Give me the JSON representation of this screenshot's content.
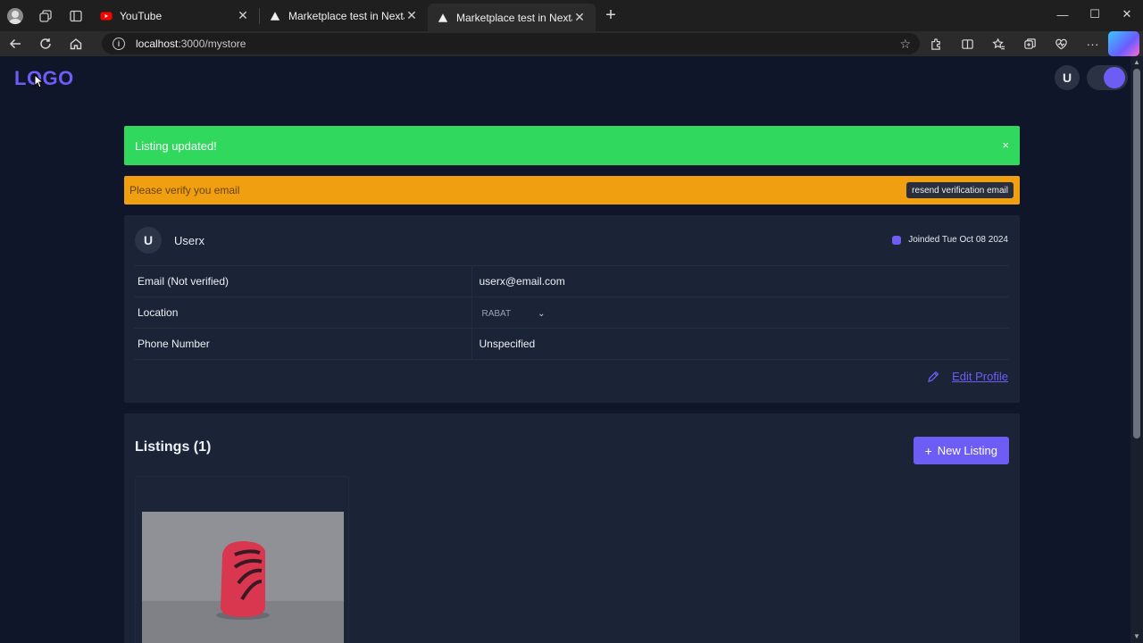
{
  "browser": {
    "tabs": [
      {
        "title": "YouTube",
        "favicon": "youtube-icon"
      },
      {
        "title": "Marketplace test in NextJS",
        "favicon": "nextjs-icon"
      },
      {
        "title": "Marketplace test in NextJS",
        "favicon": "nextjs-icon",
        "active": true
      }
    ],
    "url_host": "localhost",
    "url_path": ":3000/mystore"
  },
  "header": {
    "logo": "LOGO",
    "avatar_initial": "U"
  },
  "alerts": {
    "success": {
      "text": "Listing updated!",
      "close": "×"
    },
    "warning": {
      "text": "Please verify you email",
      "action": "resend verification email"
    }
  },
  "profile": {
    "initial": "U",
    "username": "Userx",
    "joined": "Joinded Tue Oct 08 2024",
    "rows": [
      {
        "label": "Email (Not verified)",
        "value": "userx@email.com"
      },
      {
        "label": "Location",
        "value": "RABAT"
      },
      {
        "label": "Phone Number",
        "value": "Unspecified"
      }
    ],
    "edit_label": "Edit Profile"
  },
  "listings": {
    "title": "Listings (1)",
    "new_button": "New Listing",
    "count": 1
  },
  "colors": {
    "accent": "#6d5df5",
    "success": "#30d95e",
    "warning": "#ef9f10",
    "page_bg": "#0f1629",
    "card_bg": "#1b2436"
  }
}
